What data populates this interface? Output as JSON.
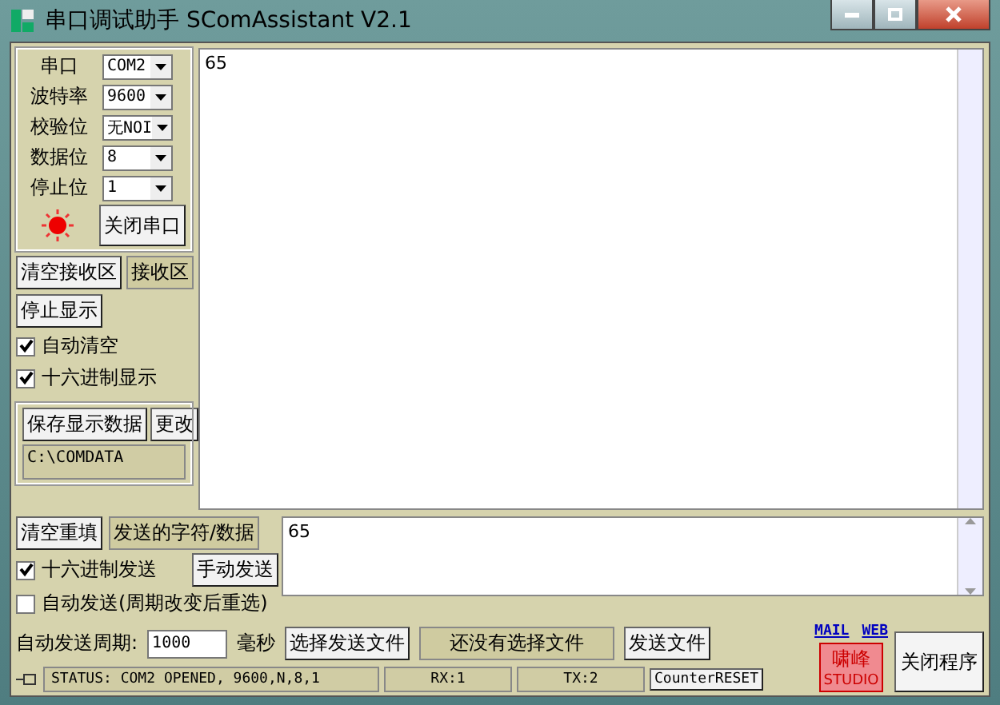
{
  "window": {
    "title": "串口调试助手 SComAssistant V2.1"
  },
  "serial_settings": [
    {
      "label": "串口",
      "value": "COM2"
    },
    {
      "label": "波特率",
      "value": "9600"
    },
    {
      "label": "校验位",
      "value": "无NOI"
    },
    {
      "label": "数据位",
      "value": "8"
    },
    {
      "label": "停止位",
      "value": "1"
    }
  ],
  "indicator": {
    "on": true
  },
  "port_button": "关闭串口",
  "receive": {
    "clear_button": "清空接收区",
    "label": "接收区",
    "stop_button": "停止显示",
    "options": [
      {
        "label": "自动清空",
        "checked": true
      },
      {
        "label": "十六进制显示",
        "checked": true
      }
    ],
    "save_button": "保存显示数据",
    "change_button": "更改",
    "save_path": "C:\\COMDATA",
    "text": "65"
  },
  "send": {
    "clear_button": "清空重填",
    "label": "发送的字符/数据",
    "hex_send": {
      "label": "十六进制发送",
      "checked": true
    },
    "manual_button": "手动发送",
    "auto_send": {
      "label": "自动发送(周期改变后重选)",
      "checked": false
    },
    "period_label": "自动发送周期:",
    "period_value": "1000",
    "period_unit": "毫秒",
    "text": "65"
  },
  "file": {
    "choose_button": "选择发送文件",
    "status": "还没有选择文件",
    "send_button": "发送文件"
  },
  "links": [
    "MAIL",
    "WEB"
  ],
  "logo": {
    "top": "啸峰",
    "bottom": "STUDIO"
  },
  "close_button": "关闭程序",
  "status_bar": {
    "status": "STATUS: COM2 OPENED, 9600,N,8,1",
    "rx": "RX:1",
    "tx": "TX:2",
    "reset_button": "CounterRESET"
  }
}
